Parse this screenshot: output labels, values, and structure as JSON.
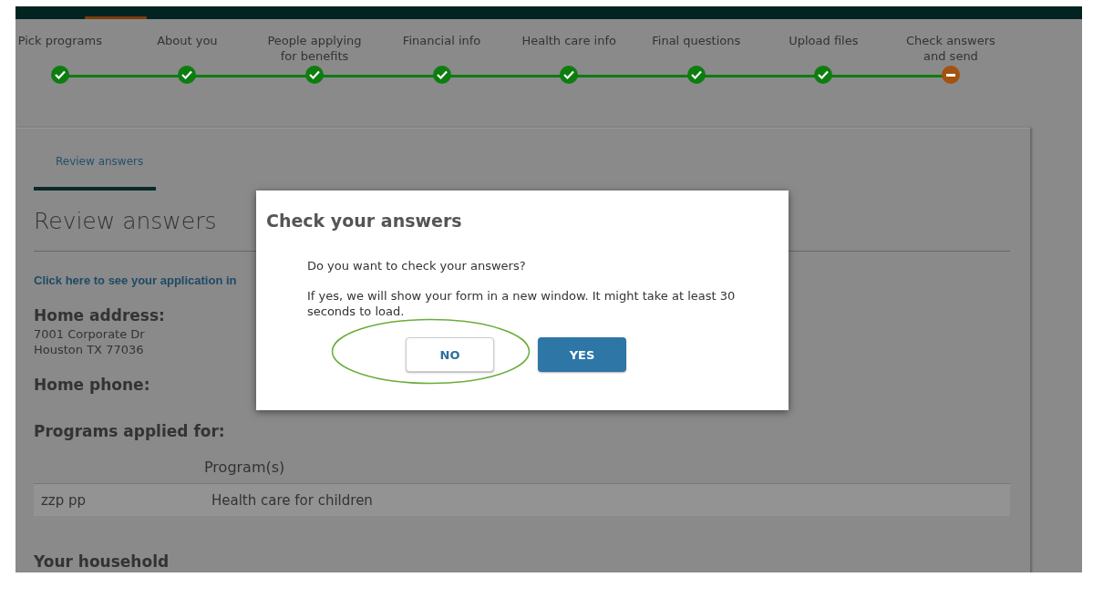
{
  "steps": [
    {
      "label": "Pick programs",
      "completed": true
    },
    {
      "label": "About you",
      "completed": true
    },
    {
      "label": "People applying for benefits",
      "completed": true
    },
    {
      "label": "Financial info",
      "completed": true
    },
    {
      "label": "Health care info",
      "completed": true
    },
    {
      "label": "Final questions",
      "completed": true
    },
    {
      "label": "Upload files",
      "completed": true
    },
    {
      "label": "Check answers and send",
      "completed": false
    }
  ],
  "section_tab": {
    "label": "Review answers"
  },
  "heading": "Review answers",
  "application_link": "Click here to see your application in",
  "home_address": {
    "label": "Home address:",
    "lines": [
      "7001 Corporate Dr",
      "Houston TX 77036"
    ]
  },
  "home_phone": {
    "label": "Home phone:"
  },
  "programs": {
    "label": "Programs applied for:",
    "columns": [
      "",
      "Program(s)"
    ],
    "rows": [
      [
        "zzp pp",
        "Health care for children"
      ]
    ]
  },
  "next_section": "Your household",
  "dialog": {
    "title": "Check your answers",
    "paragraphs": [
      "Do you want to check your answers?",
      "If yes, we will show your form in a new window. It might take at least 30 seconds to load."
    ],
    "buttons": [
      {
        "label": "NO",
        "kind": "secondary",
        "highlighted": true
      },
      {
        "label": "YES",
        "kind": "primary",
        "highlighted": false
      }
    ]
  }
}
